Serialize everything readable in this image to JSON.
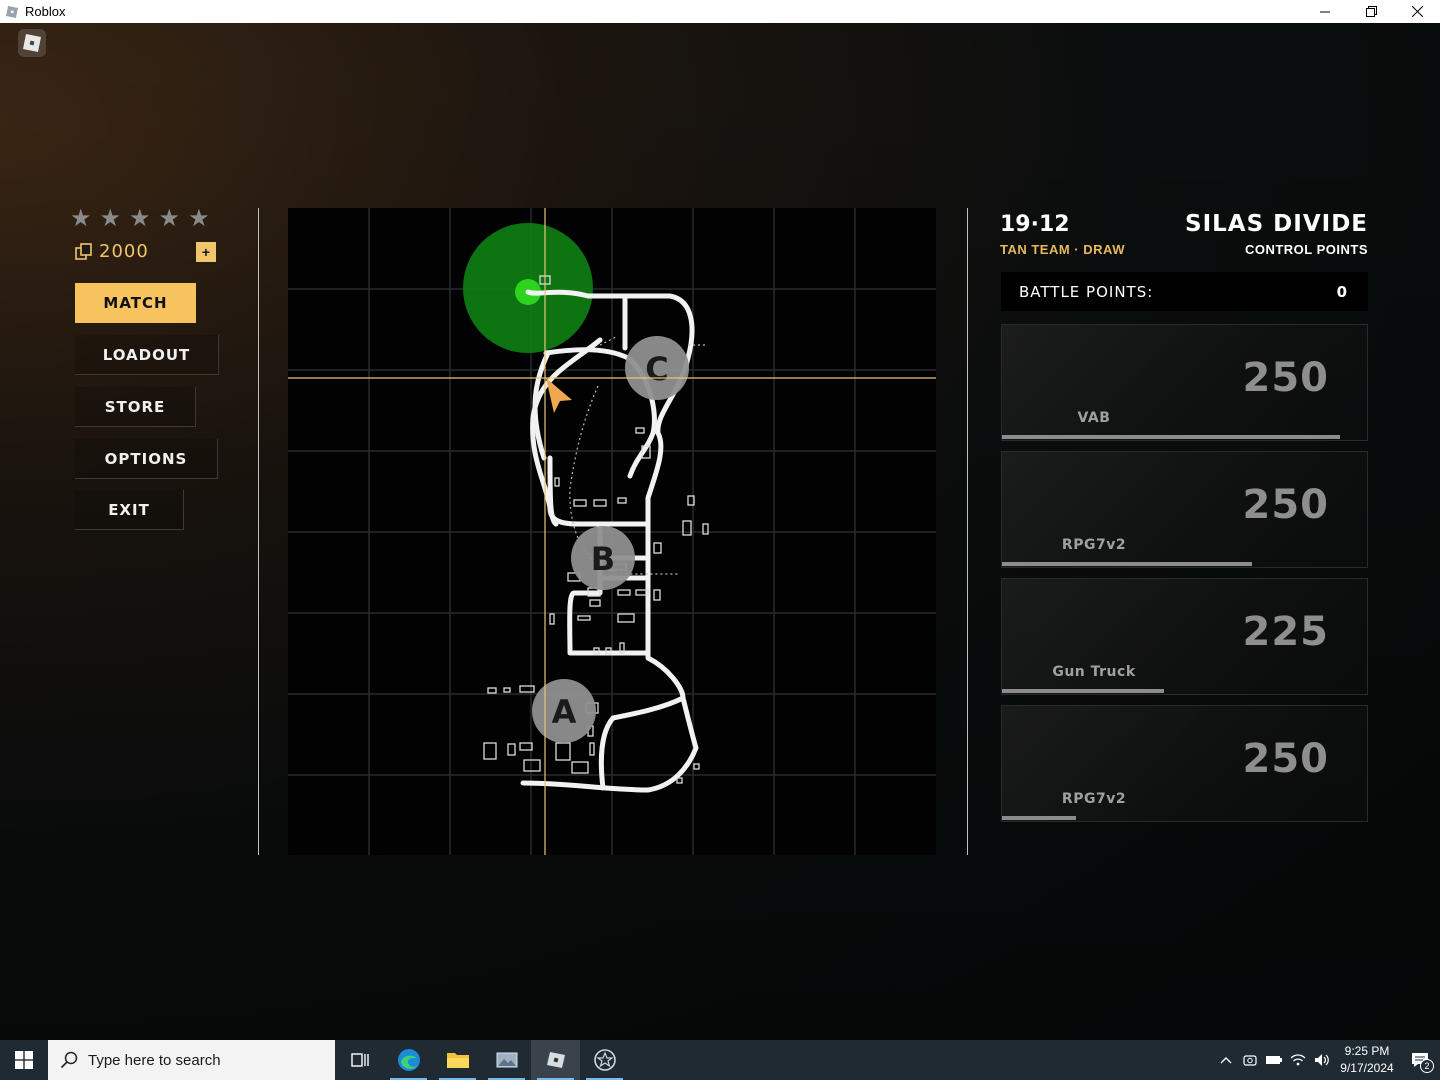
{
  "window": {
    "title": "Roblox"
  },
  "player": {
    "stars_total": 5,
    "stars_filled": 0,
    "currency": "2000",
    "add_label": "+"
  },
  "menu": [
    {
      "label": "MATCH",
      "active": true
    },
    {
      "label": "LOADOUT",
      "active": false
    },
    {
      "label": "STORE",
      "active": false
    },
    {
      "label": "OPTIONS",
      "active": false
    },
    {
      "label": "EXIT",
      "active": false
    }
  ],
  "match": {
    "score": "19·12",
    "status": "TAN TEAM · DRAW",
    "map_name": "SILAS DIVIDE",
    "mode": "CONTROL POINTS",
    "battle_points_label": "BATTLE POINTS:",
    "battle_points_value": "0"
  },
  "map": {
    "control_points": [
      "C",
      "B",
      "A"
    ]
  },
  "cards": [
    {
      "name": "VAB",
      "cost": "250",
      "progress": 0.96
    },
    {
      "name": "RPG7v2",
      "cost": "250",
      "progress": 0.71
    },
    {
      "name": "Gun Truck",
      "cost": "225",
      "progress": 0.46
    },
    {
      "name": "RPG7v2",
      "cost": "250",
      "progress": 0.21
    }
  ],
  "colors": {
    "accent": "#f6c35f",
    "currency": "#f2c46b",
    "team": "#e8b95a",
    "spawn": "#22a31e"
  },
  "taskbar": {
    "search_placeholder": "Type here to search",
    "time": "9:25 PM",
    "date": "9/17/2024",
    "notification_count": "2",
    "icons": [
      "task-view-icon",
      "edge-icon",
      "file-explorer-icon",
      "photos-icon",
      "roblox-icon",
      "roblox-studio-icon"
    ]
  }
}
